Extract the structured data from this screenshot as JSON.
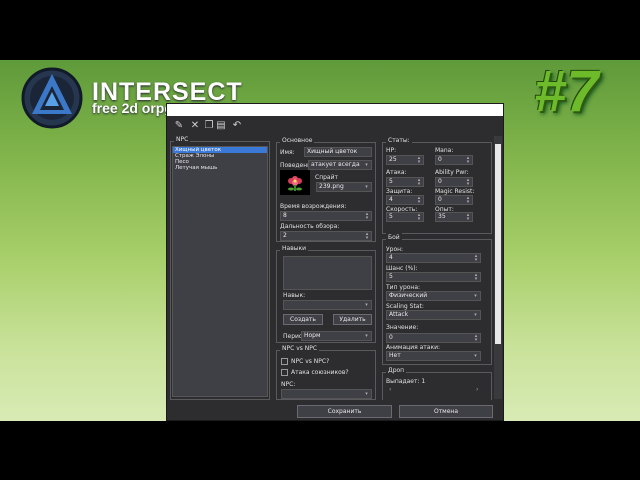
{
  "overlay": {
    "brand": "INTERSECT",
    "tagline": "free 2d orpg engine",
    "episode": "#7"
  },
  "toolbar": {
    "icons": [
      "new-icon",
      "delete-icon",
      "copy-icon",
      "paste-icon",
      "undo-icon"
    ]
  },
  "npc_list": {
    "title": "NPC",
    "items": [
      "Хищный цветок",
      "Страж Элоны",
      "Пеcо",
      "Летучая мышь"
    ],
    "selected": 0
  },
  "general": {
    "title": "Основное",
    "name_label": "Имя:",
    "name_value": "Хищный цветок",
    "behavior_label": "Поведение:",
    "behavior_value": "атакует всегда",
    "sprite_label": "Спрайт",
    "sprite_value": "239.png",
    "spawn_label": "Время возрождения:",
    "spawn_value": "8",
    "sight_label": "Дальность обзора:",
    "sight_value": "2"
  },
  "skills": {
    "title": "Навыки",
    "skill_label": "Навык:",
    "add_button": "Создать",
    "remove_button": "Удалить",
    "frequency_label": "Период:",
    "frequency_value": "Норм"
  },
  "npc_vs_npc": {
    "title": "NPC vs NPC",
    "check1": "NPC vs NPC?",
    "check2": "Атака союзников?",
    "npc_label": "NPC:"
  },
  "stats": {
    "title": "Статы:",
    "hp_label": "HP:",
    "hp_value": "25",
    "mana_label": "Mana:",
    "mana_value": "0",
    "attack_label": "Атака:",
    "attack_value": "5",
    "ability_label": "Ability Pwr:",
    "ability_value": "0",
    "defense_label": "Защита:",
    "defense_value": "4",
    "resist_label": "Magic Resist:",
    "resist_value": "0",
    "speed_label": "Скорость:",
    "speed_value": "5",
    "exp_label": "Опыт:",
    "exp_value": "35"
  },
  "combat": {
    "title": "Бой",
    "damage_label": "Урон:",
    "damage_value": "4",
    "crit_label": "Шанс (%):",
    "crit_value": "5",
    "damage_type_label": "Тип урона:",
    "damage_type_value": "Физический",
    "scaling_label": "Scaling Stat:",
    "scaling_value": "Attack",
    "scaling_amount_label": "Значение:",
    "scaling_amount_value": "0",
    "animation_label": "Анимация атаки:",
    "animation_value": "Нет"
  },
  "drops": {
    "title": "Дроп",
    "drops_label": "Выпадает: 1"
  },
  "footer": {
    "save_button": "Сохранить",
    "cancel_button": "Отмена"
  }
}
